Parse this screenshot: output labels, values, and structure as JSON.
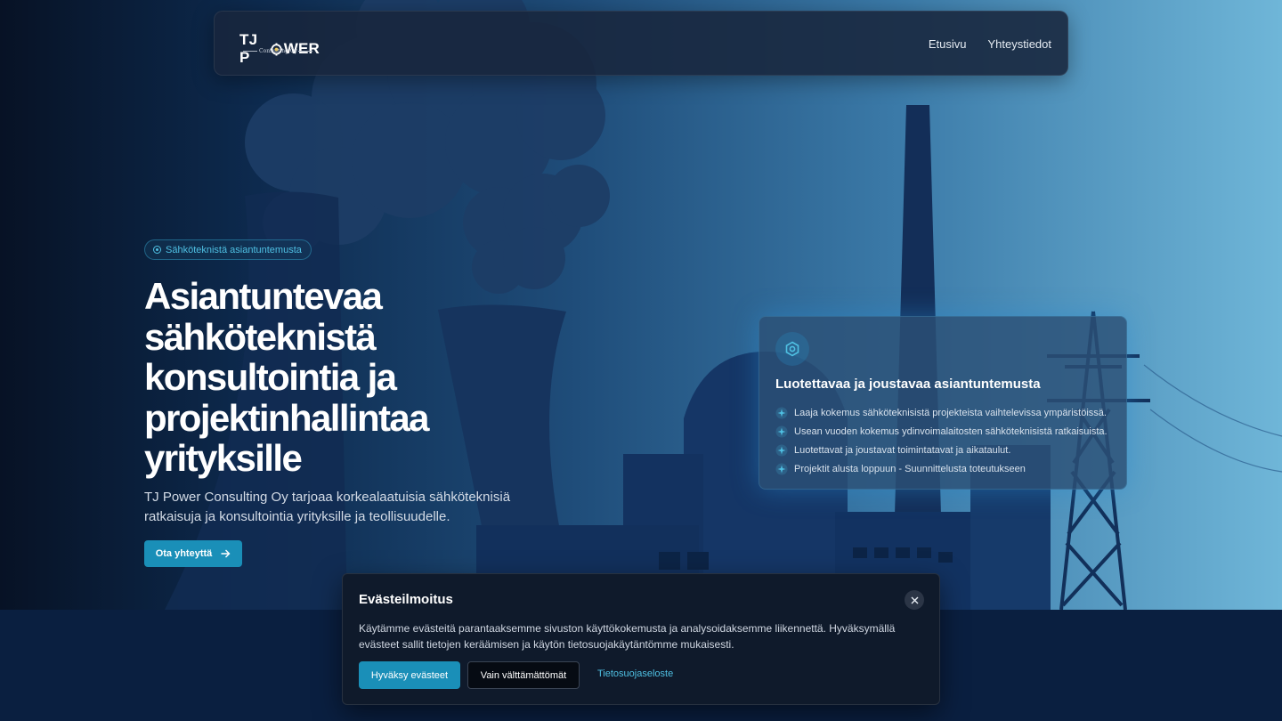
{
  "brand": {
    "name": "TJ POWER",
    "name_before_gear": "TJ P",
    "name_after_gear": "WER",
    "subtitle": "Consulting Oy"
  },
  "nav": {
    "items": [
      {
        "label": "Etusivu"
      },
      {
        "label": "Yhteystiedot"
      }
    ]
  },
  "hero": {
    "badge": "Sähköteknistä asiantuntemusta",
    "title": "Asiantuntevaa sähköteknistä konsultointia ja projektinhallintaa yrityksille",
    "description": "TJ Power Consulting Oy tarjoaa korkealaatuisia sähköteknisiä ratkaisuja ja konsultointia yrityksille ja teollisuudelle.",
    "cta_label": "Ota yhteyttä"
  },
  "card": {
    "title": "Luotettavaa ja joustavaa asiantuntemusta",
    "items": [
      "Laaja kokemus sähköteknisistä projekteista vaihtelevissa ympäristöissä.",
      "Usean vuoden kokemus ydinvoimalaitosten sähköteknisistä ratkaisuista.",
      "Luotettavat ja joustavat toimintatavat ja aikataulut.",
      "Projektit alusta loppuun - Suunnittelusta toteutukseen"
    ]
  },
  "cookie": {
    "title": "Evästeilmoitus",
    "text": "Käytämme evästeitä parantaaksemme sivuston käyttökokemusta ja analysoidaksemme liikennettä. Hyväksymällä evästeet sallit tietojen keräämisen ja käytön tietosuojakäytäntömme mukaisesti.",
    "accept_label": "Hyväksy evästeet",
    "necessary_label": "Vain välttämättömät",
    "privacy_label": "Tietosuojaseloste"
  },
  "colors": {
    "accent": "#1a8fb8",
    "accent_text": "#4fc0e3",
    "navbar_bg": "#18263c",
    "cookie_bg": "#0f1a2b"
  },
  "icons": {
    "badge": "target-icon",
    "card": "hexagon-icon",
    "list": "sparkle-icon",
    "cta": "arrow-right-icon",
    "close": "close-icon"
  }
}
